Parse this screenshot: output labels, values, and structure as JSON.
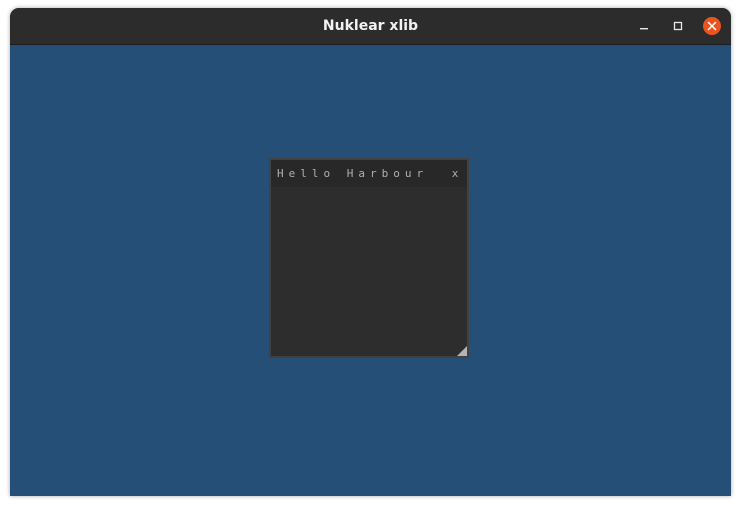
{
  "os_window": {
    "title": "Nuklear xlib",
    "controls": {
      "minimize_icon": "minimize-icon",
      "maximize_icon": "maximize-icon",
      "close_icon": "close-icon",
      "close_color": "#e9541f"
    },
    "background_color": "#264f78"
  },
  "nk_window": {
    "title": "Hello Harbour",
    "close_label": "x",
    "resize_icon": "resize-grip-icon",
    "body_color": "#2d2d2d",
    "header_color": "#282828",
    "border_color": "#414141"
  }
}
